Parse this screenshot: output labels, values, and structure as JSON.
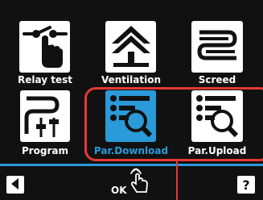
{
  "tiles": [
    {
      "label": "Relay test",
      "icon": "relay-switch-icon"
    },
    {
      "label": "Ventilation",
      "icon": "ventilation-icon"
    },
    {
      "label": "Screed",
      "icon": "screed-icon"
    },
    {
      "label": "Program",
      "icon": "program-icon"
    },
    {
      "label": "Par.Download",
      "icon": "parameter-search-icon",
      "selected": true
    },
    {
      "label": "Par.Upload",
      "icon": "parameter-search-icon"
    }
  ],
  "footer": {
    "back_icon": "arrow-left-icon",
    "ok_label": "OK",
    "ok_icon": "tap-hand-icon",
    "help_label": "?",
    "help_icon": "question-icon"
  },
  "colors": {
    "accent": "#2a9ad8",
    "highlight": "#e53935",
    "background": "#111111"
  }
}
